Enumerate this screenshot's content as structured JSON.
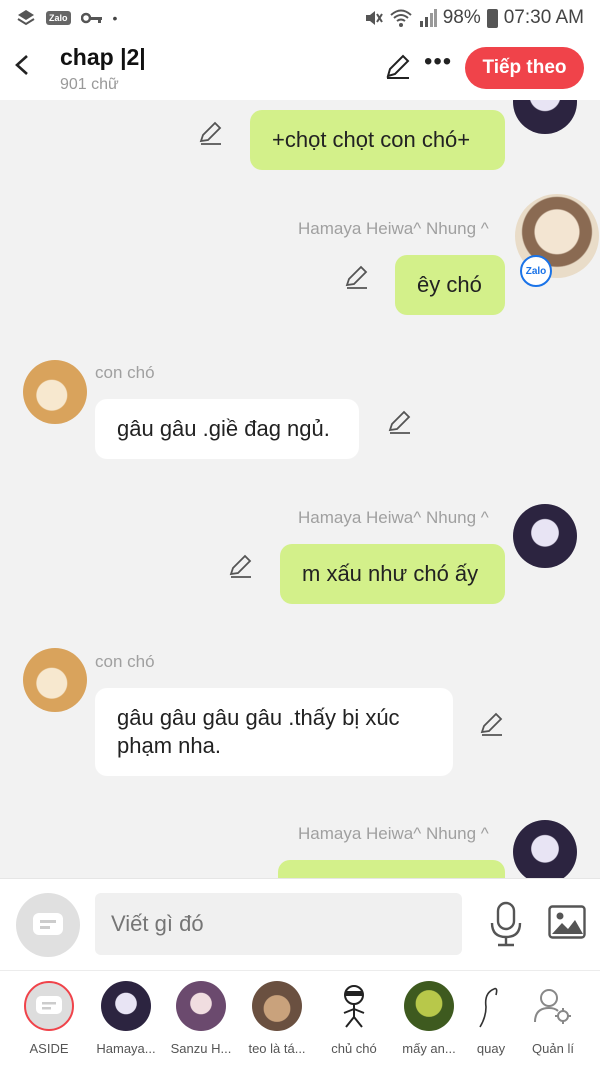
{
  "status_bar": {
    "battery": "98%",
    "time": "07:30 AM",
    "zalo_badge": "Zalo"
  },
  "header": {
    "title": "chap |2|",
    "subtitle": "901 chữ",
    "next_button": "Tiếp theo"
  },
  "messages": [
    {
      "side": "right",
      "sender": "",
      "text": "+chọt chọt con chó+"
    },
    {
      "side": "right",
      "sender": "Hamaya Heiwa^ Nhung ^",
      "text": "êy chó",
      "badge": "Zalo"
    },
    {
      "side": "left",
      "sender": "con chó",
      "text": "gâu gâu .giề đag ngủ."
    },
    {
      "side": "right",
      "sender": "Hamaya Heiwa^ Nhung ^",
      "text": "m xấu như chó ấy"
    },
    {
      "side": "left",
      "sender": "con chó",
      "text_line1": "gâu gâu gâu gâu .thấy bị xúc",
      "text_line2": "phạm nha."
    },
    {
      "side": "right",
      "sender": "Hamaya Heiwa^ Nhung ^",
      "text": ""
    }
  ],
  "input": {
    "placeholder": "Viết gì đó"
  },
  "characters": [
    {
      "label": "ASIDE"
    },
    {
      "label": "Hamaya..."
    },
    {
      "label": "Sanzu H..."
    },
    {
      "label": "teo là tá..."
    },
    {
      "label": "chủ chó"
    },
    {
      "label": "mấy an..."
    },
    {
      "label": "quay"
    },
    {
      "label": "Quản lí"
    }
  ],
  "colors": {
    "accent": "#f0434a",
    "bubble_green": "#d3f08a",
    "bubble_white": "#ffffff"
  }
}
